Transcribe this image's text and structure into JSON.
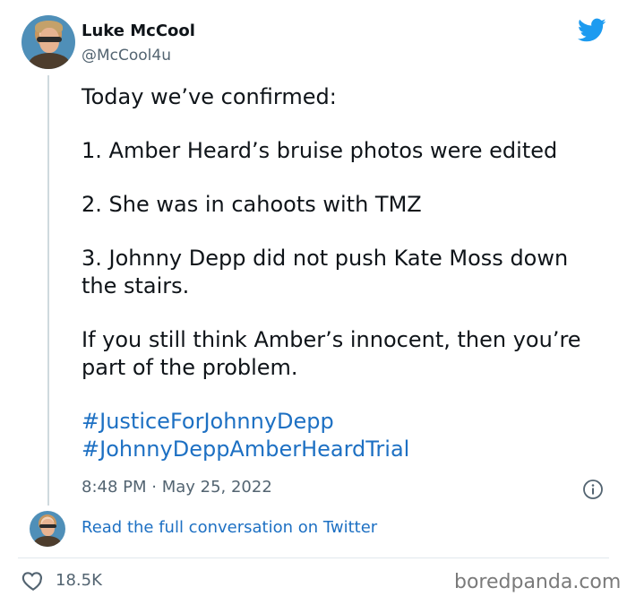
{
  "author": {
    "name": "Luke McCool",
    "handle": "@McCool4u"
  },
  "tweet": {
    "paragraphs": [
      "Today we’ve confirmed:",
      "1. Amber Heard’s bruise photos were edited",
      "2. She was in cahoots with TMZ",
      "3. Johnny Depp did not push Kate Moss down the stairs.",
      "If you still think Amber’s innocent, then you’re part of the problem."
    ],
    "hashtags": [
      "#JusticeForJohnnyDepp",
      "#JohnnyDeppAmberHeardTrial"
    ],
    "timestamp": "8:48 PM · May 25, 2022"
  },
  "footer": {
    "read_more": "Read the full conversation on Twitter",
    "likes": "18.5K"
  },
  "watermark": "boredpanda.com",
  "colors": {
    "link": "#1d70c3",
    "twitter_blue": "#1d9bf0",
    "secondary_text": "#536471"
  },
  "icons": {
    "brand": "twitter-bird-icon",
    "info": "info-icon",
    "like": "heart-icon"
  }
}
